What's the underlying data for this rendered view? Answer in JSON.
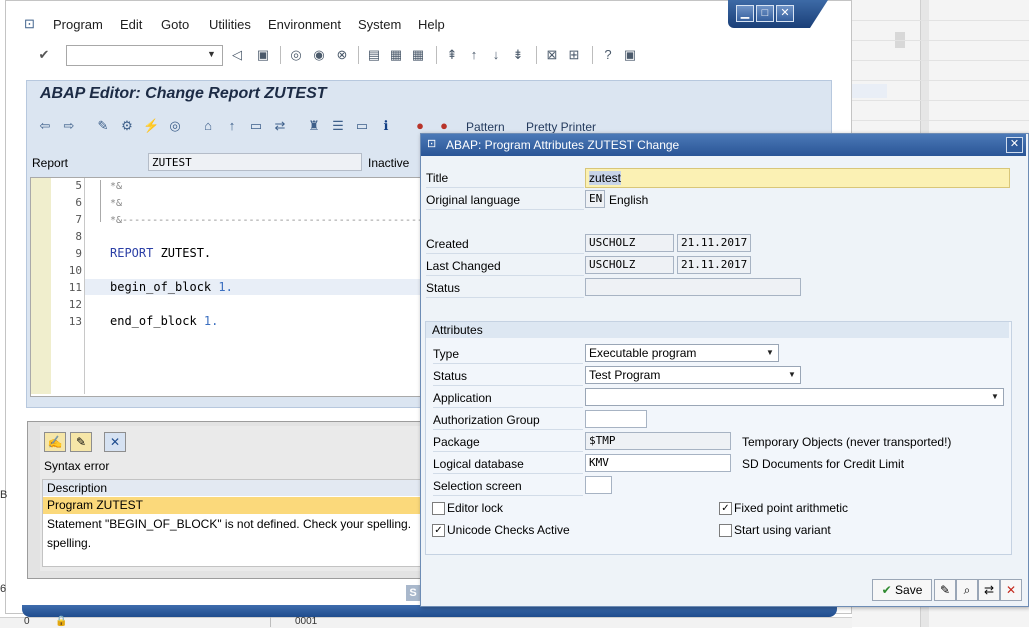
{
  "menu": [
    "Program",
    "Edit",
    "Goto",
    "Utilities",
    "Environment",
    "System",
    "Help"
  ],
  "editor": {
    "title": "ABAP Editor: Change Report ZUTEST",
    "pattern_label": "Pattern",
    "pretty_printer_label": "Pretty Printer",
    "report_label": "Report",
    "report_value": "ZUTEST",
    "status_label": "Inactive",
    "lines": [
      {
        "n": "5",
        "text": "*&"
      },
      {
        "n": "6",
        "text": "*&"
      },
      {
        "n": "7",
        "text": "*&---------------------------------------------------"
      },
      {
        "n": "8",
        "text": ""
      },
      {
        "n": "9",
        "kw": "REPORT",
        "rest": " ZUTEST."
      },
      {
        "n": "10",
        "text": ""
      },
      {
        "n": "11",
        "kw": "begin_of_block",
        "num": " 1."
      },
      {
        "n": "12",
        "text": ""
      },
      {
        "n": "13",
        "kw": "end_of_block",
        "num": " 1."
      }
    ]
  },
  "errors": {
    "title": "Syntax error",
    "column_description": "Description",
    "row_program": "Program ZUTEST",
    "message": "Statement \"BEGIN_OF_BLOCK\" is not defined. Check your spelling.",
    "message_cont": "spelling."
  },
  "statusbar": {
    "left": "0",
    "mid": "0001",
    "edge": [
      "S",
      "B",
      "6"
    ]
  },
  "dialog": {
    "title": "ABAP: Program Attributes ZUTEST Change",
    "title_label": "Title",
    "title_value": "zutest",
    "orig_lang_label": "Original language",
    "orig_lang_code": "EN",
    "orig_lang_name": "English",
    "created_label": "Created",
    "created_user": "USCHOLZ",
    "created_date": "21.11.2017",
    "changed_label": "Last Changed",
    "changed_user": "USCHOLZ",
    "changed_date": "21.11.2017",
    "status_label": "Status",
    "status_value": "",
    "attributes": {
      "header": "Attributes",
      "type_label": "Type",
      "type_value": "Executable program",
      "status_label": "Status",
      "status_value": "Test Program",
      "application_label": "Application",
      "application_value": "",
      "auth_label": "Authorization Group",
      "auth_value": "",
      "package_label": "Package",
      "package_value": "$TMP",
      "package_desc": "Temporary Objects (never transported!)",
      "ldb_label": "Logical database",
      "ldb_value": "KMV",
      "ldb_desc": "SD Documents for Credit Limit",
      "selscreen_label": "Selection screen",
      "selscreen_value": "",
      "editor_lock_label": "Editor lock",
      "editor_lock": false,
      "fixed_point_label": "Fixed point arithmetic",
      "fixed_point": true,
      "unicode_label": "Unicode Checks Active",
      "unicode": true,
      "variant_label": "Start using variant",
      "variant": false
    },
    "save_label": "Save"
  }
}
